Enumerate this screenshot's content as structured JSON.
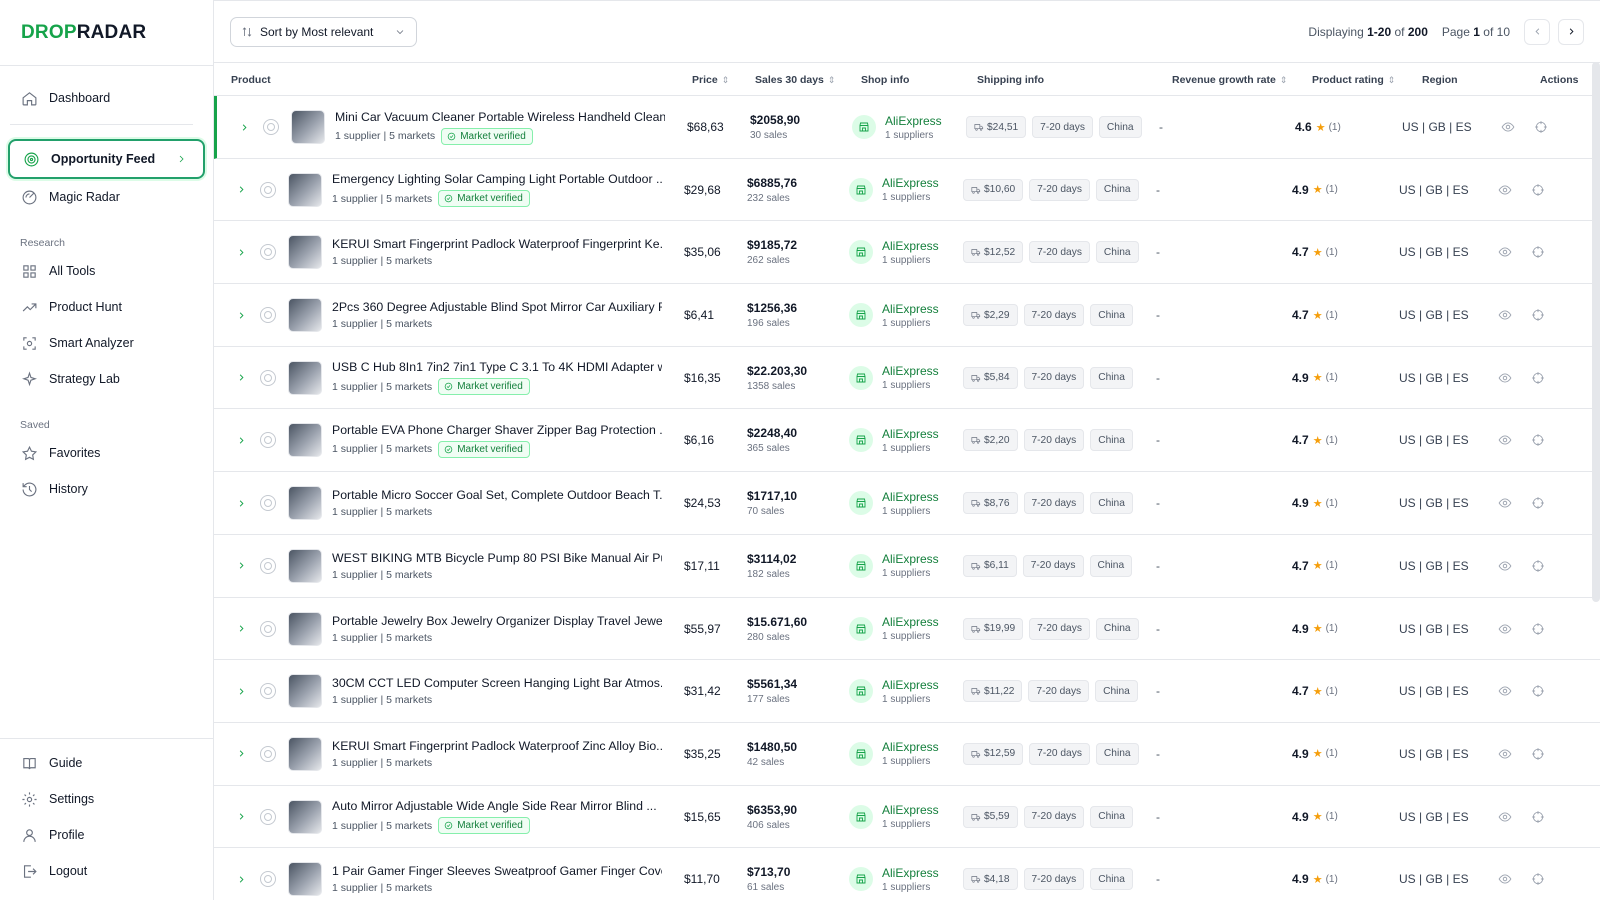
{
  "brand": {
    "part1": "DROP",
    "part2": "RADAR",
    "accent_color": "#16a34a"
  },
  "sidebar": {
    "main_items": [
      {
        "label": "Dashboard",
        "icon": "home-icon"
      },
      {
        "label": "Opportunity Feed",
        "icon": "target-icon",
        "active": true
      },
      {
        "label": "Magic Radar",
        "icon": "radar-icon"
      }
    ],
    "research_label": "Research",
    "research_items": [
      {
        "label": "All Tools",
        "icon": "grid-icon"
      },
      {
        "label": "Product Hunt",
        "icon": "trend-icon"
      },
      {
        "label": "Smart Analyzer",
        "icon": "scan-icon"
      },
      {
        "label": "Strategy Lab",
        "icon": "sparkle-icon"
      }
    ],
    "saved_label": "Saved",
    "saved_items": [
      {
        "label": "Favorites",
        "icon": "star-icon"
      },
      {
        "label": "History",
        "icon": "history-icon"
      }
    ],
    "bottom_items": [
      {
        "label": "Guide",
        "icon": "book-icon"
      },
      {
        "label": "Settings",
        "icon": "gear-icon"
      },
      {
        "label": "Profile",
        "icon": "user-icon"
      },
      {
        "label": "Logout",
        "icon": "logout-icon"
      }
    ]
  },
  "toolbar": {
    "sort_label": "Sort by Most relevant",
    "display_prefix": "Displaying",
    "display_range": "1-20",
    "display_of": "of",
    "display_total": "200",
    "page_prefix": "Page",
    "page_current": "1",
    "page_of": "of",
    "page_total": "10"
  },
  "table": {
    "headers": {
      "product": "Product",
      "price": "Price",
      "sales": "Sales 30 days",
      "shop": "Shop info",
      "shipping": "Shipping info",
      "growth": "Revenue growth rate",
      "rating": "Product rating",
      "region": "Region",
      "actions": "Actions"
    },
    "rows": [
      {
        "title": "Mini Car Vacuum Cleaner Portable Wireless Handheld Clean...",
        "meta": "1 supplier | 5 markets",
        "verified": true,
        "price": "$68,63",
        "sales_amount": "$2058,90",
        "sales_count": "30 sales",
        "shop": "AliExpress",
        "suppliers": "1 suppliers",
        "ship_cost": "$24,51",
        "ship_time": "7-20 days",
        "ship_from": "China",
        "growth": "-",
        "rating": "4.6",
        "rating_count": "(1)",
        "region": "US | GB | ES"
      },
      {
        "title": "Emergency Lighting Solar Camping Light Portable Outdoor ...",
        "meta": "1 supplier | 5 markets",
        "verified": true,
        "price": "$29,68",
        "sales_amount": "$6885,76",
        "sales_count": "232 sales",
        "shop": "AliExpress",
        "suppliers": "1 suppliers",
        "ship_cost": "$10,60",
        "ship_time": "7-20 days",
        "ship_from": "China",
        "growth": "-",
        "rating": "4.9",
        "rating_count": "(1)",
        "region": "US | GB | ES"
      },
      {
        "title": "KERUI Smart Fingerprint Padlock Waterproof Fingerprint Ke...",
        "meta": "1 supplier | 5 markets",
        "verified": false,
        "price": "$35,06",
        "sales_amount": "$9185,72",
        "sales_count": "262 sales",
        "shop": "AliExpress",
        "suppliers": "1 suppliers",
        "ship_cost": "$12,52",
        "ship_time": "7-20 days",
        "ship_from": "China",
        "growth": "-",
        "rating": "4.7",
        "rating_count": "(1)",
        "region": "US | GB | ES"
      },
      {
        "title": "2Pcs 360 Degree Adjustable Blind Spot Mirror Car Auxiliary R",
        "meta": "1 supplier | 5 markets",
        "verified": false,
        "price": "$6,41",
        "sales_amount": "$1256,36",
        "sales_count": "196 sales",
        "shop": "AliExpress",
        "suppliers": "1 suppliers",
        "ship_cost": "$2,29",
        "ship_time": "7-20 days",
        "ship_from": "China",
        "growth": "-",
        "rating": "4.7",
        "rating_count": "(1)",
        "region": "US | GB | ES"
      },
      {
        "title": "USB C Hub 8In1 7in2 7in1 Type C 3.1 To 4K HDMI Adapter w...",
        "meta": "1 supplier | 5 markets",
        "verified": true,
        "price": "$16,35",
        "sales_amount": "$22.203,30",
        "sales_count": "1358 sales",
        "shop": "AliExpress",
        "suppliers": "1 suppliers",
        "ship_cost": "$5,84",
        "ship_time": "7-20 days",
        "ship_from": "China",
        "growth": "-",
        "rating": "4.9",
        "rating_count": "(1)",
        "region": "US | GB | ES"
      },
      {
        "title": "Portable EVA Phone Charger Shaver Zipper Bag Protection ...",
        "meta": "1 supplier | 5 markets",
        "verified": true,
        "price": "$6,16",
        "sales_amount": "$2248,40",
        "sales_count": "365 sales",
        "shop": "AliExpress",
        "suppliers": "1 suppliers",
        "ship_cost": "$2,20",
        "ship_time": "7-20 days",
        "ship_from": "China",
        "growth": "-",
        "rating": "4.7",
        "rating_count": "(1)",
        "region": "US | GB | ES"
      },
      {
        "title": "Portable Micro Soccer Goal Set, Complete Outdoor Beach T...",
        "meta": "1 supplier | 5 markets",
        "verified": false,
        "price": "$24,53",
        "sales_amount": "$1717,10",
        "sales_count": "70 sales",
        "shop": "AliExpress",
        "suppliers": "1 suppliers",
        "ship_cost": "$8,76",
        "ship_time": "7-20 days",
        "ship_from": "China",
        "growth": "-",
        "rating": "4.9",
        "rating_count": "(1)",
        "region": "US | GB | ES"
      },
      {
        "title": "WEST BIKING MTB Bicycle Pump 80 PSI Bike Manual Air Pu...",
        "meta": "1 supplier | 5 markets",
        "verified": false,
        "price": "$17,11",
        "sales_amount": "$3114,02",
        "sales_count": "182 sales",
        "shop": "AliExpress",
        "suppliers": "1 suppliers",
        "ship_cost": "$6,11",
        "ship_time": "7-20 days",
        "ship_from": "China",
        "growth": "-",
        "rating": "4.7",
        "rating_count": "(1)",
        "region": "US | GB | ES"
      },
      {
        "title": "Portable Jewelry Box Jewelry Organizer Display Travel Jewelr",
        "meta": "1 supplier | 5 markets",
        "verified": false,
        "price": "$55,97",
        "sales_amount": "$15.671,60",
        "sales_count": "280 sales",
        "shop": "AliExpress",
        "suppliers": "1 suppliers",
        "ship_cost": "$19,99",
        "ship_time": "7-20 days",
        "ship_from": "China",
        "growth": "-",
        "rating": "4.9",
        "rating_count": "(1)",
        "region": "US | GB | ES"
      },
      {
        "title": "30CM CCT LED Computer Screen Hanging Light Bar Atmos...",
        "meta": "1 supplier | 5 markets",
        "verified": false,
        "price": "$31,42",
        "sales_amount": "$5561,34",
        "sales_count": "177 sales",
        "shop": "AliExpress",
        "suppliers": "1 suppliers",
        "ship_cost": "$11,22",
        "ship_time": "7-20 days",
        "ship_from": "China",
        "growth": "-",
        "rating": "4.7",
        "rating_count": "(1)",
        "region": "US | GB | ES"
      },
      {
        "title": "KERUI Smart Fingerprint Padlock Waterproof Zinc Alloy Bio...",
        "meta": "1 supplier | 5 markets",
        "verified": false,
        "price": "$35,25",
        "sales_amount": "$1480,50",
        "sales_count": "42 sales",
        "shop": "AliExpress",
        "suppliers": "1 suppliers",
        "ship_cost": "$12,59",
        "ship_time": "7-20 days",
        "ship_from": "China",
        "growth": "-",
        "rating": "4.9",
        "rating_count": "(1)",
        "region": "US | GB | ES"
      },
      {
        "title": "Auto Mirror Adjustable Wide Angle Side Rear Mirror Blind ...",
        "meta": "1 supplier | 5 markets",
        "verified": true,
        "price": "$15,65",
        "sales_amount": "$6353,90",
        "sales_count": "406 sales",
        "shop": "AliExpress",
        "suppliers": "1 suppliers",
        "ship_cost": "$5,59",
        "ship_time": "7-20 days",
        "ship_from": "China",
        "growth": "-",
        "rating": "4.9",
        "rating_count": "(1)",
        "region": "US | GB | ES"
      },
      {
        "title": "1 Pair Gamer Finger Sleeves Sweatproof Gamer Finger Cove...",
        "meta": "1 supplier | 5 markets",
        "verified": false,
        "price": "$11,70",
        "sales_amount": "$713,70",
        "sales_count": "61 sales",
        "shop": "AliExpress",
        "suppliers": "1 suppliers",
        "ship_cost": "$4,18",
        "ship_time": "7-20 days",
        "ship_from": "China",
        "growth": "-",
        "rating": "4.9",
        "rating_count": "(1)",
        "region": "US | GB | ES"
      }
    ],
    "verified_label": "Market verified"
  }
}
